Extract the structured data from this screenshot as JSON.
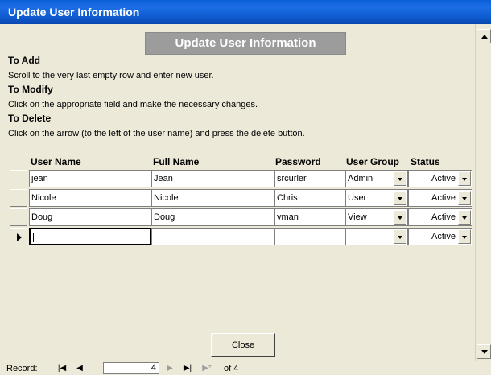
{
  "window": {
    "title": "Update User Information"
  },
  "header": {
    "title": "Update User Information"
  },
  "instructions": [
    {
      "heading": "To Add",
      "text": "Scroll to the very last empty row and enter new user."
    },
    {
      "heading": "To Modify",
      "text": "Click on the appropriate field and make the necessary changes."
    },
    {
      "heading": "To Delete",
      "text": "Click on the arrow (to the left of the user name) and press the delete button."
    }
  ],
  "columns": {
    "user_name": "User Name",
    "full_name": "Full Name",
    "password": "Password",
    "user_group": "User Group",
    "status": "Status"
  },
  "rows": [
    {
      "user_name": "jean",
      "full_name": "Jean",
      "password": "srcurler",
      "user_group": "Admin",
      "status": "Active"
    },
    {
      "user_name": "Nicole",
      "full_name": "Nicole",
      "password": "Chris",
      "user_group": "User",
      "status": "Active"
    },
    {
      "user_name": "Doug",
      "full_name": "Doug",
      "password": "vman",
      "user_group": "View",
      "status": "Active"
    },
    {
      "user_name": "",
      "full_name": "",
      "password": "",
      "user_group": "",
      "status": "Active"
    }
  ],
  "buttons": {
    "close": "Close"
  },
  "navigation": {
    "record_label": "Record:",
    "current_record": "4",
    "of_text": "of 4",
    "first": "|◀",
    "prev": "◀",
    "next": "▶",
    "last": "▶|",
    "new": "▶*"
  },
  "colors": {
    "titlebar": "#0a5fd9",
    "header_bar": "#9c9c9c",
    "background": "#ece9d8"
  }
}
